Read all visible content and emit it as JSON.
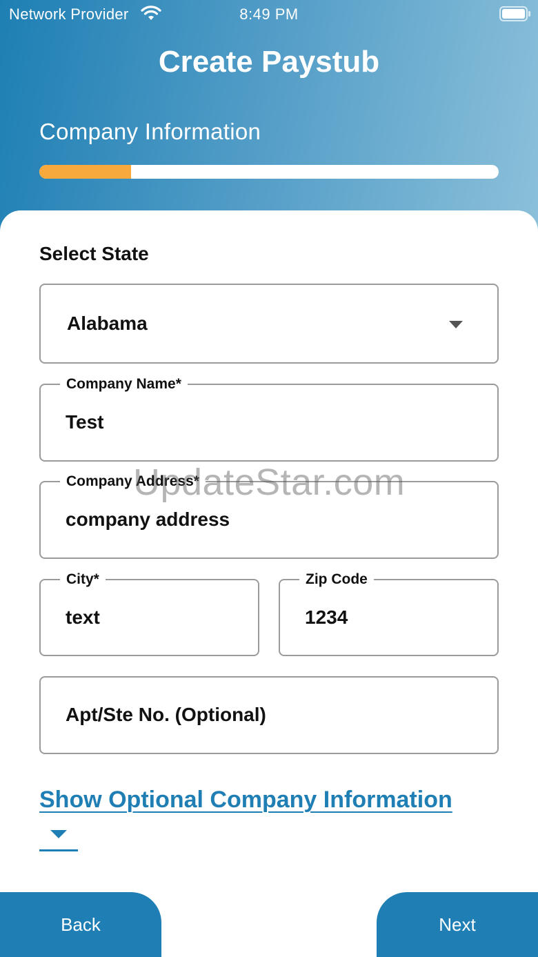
{
  "status_bar": {
    "carrier": "Network Provider",
    "time": "8:49 PM"
  },
  "header": {
    "title": "Create Paystub",
    "step": "Company Information",
    "progress_fraction": 0.2,
    "progress_color": "#f8a93c"
  },
  "form": {
    "state": {
      "label": "Select State",
      "value": "Alabama"
    },
    "company_name": {
      "label": "Company Name*",
      "value": "Test"
    },
    "company_address": {
      "label": "Company Address*",
      "value": "company address"
    },
    "city": {
      "label": "City*",
      "value": "text"
    },
    "zip": {
      "label": "Zip Code",
      "value": "1234"
    },
    "apt": {
      "placeholder": "Apt/Ste No. (Optional)"
    },
    "optional_toggle": "Show Optional Company Information"
  },
  "actions": {
    "back": "Back",
    "next": "Next"
  },
  "watermark": "UpdateStar.com",
  "colors": {
    "primary": "#1f7fb4",
    "accent": "#f8a93c",
    "border": "#9a9a9a"
  }
}
